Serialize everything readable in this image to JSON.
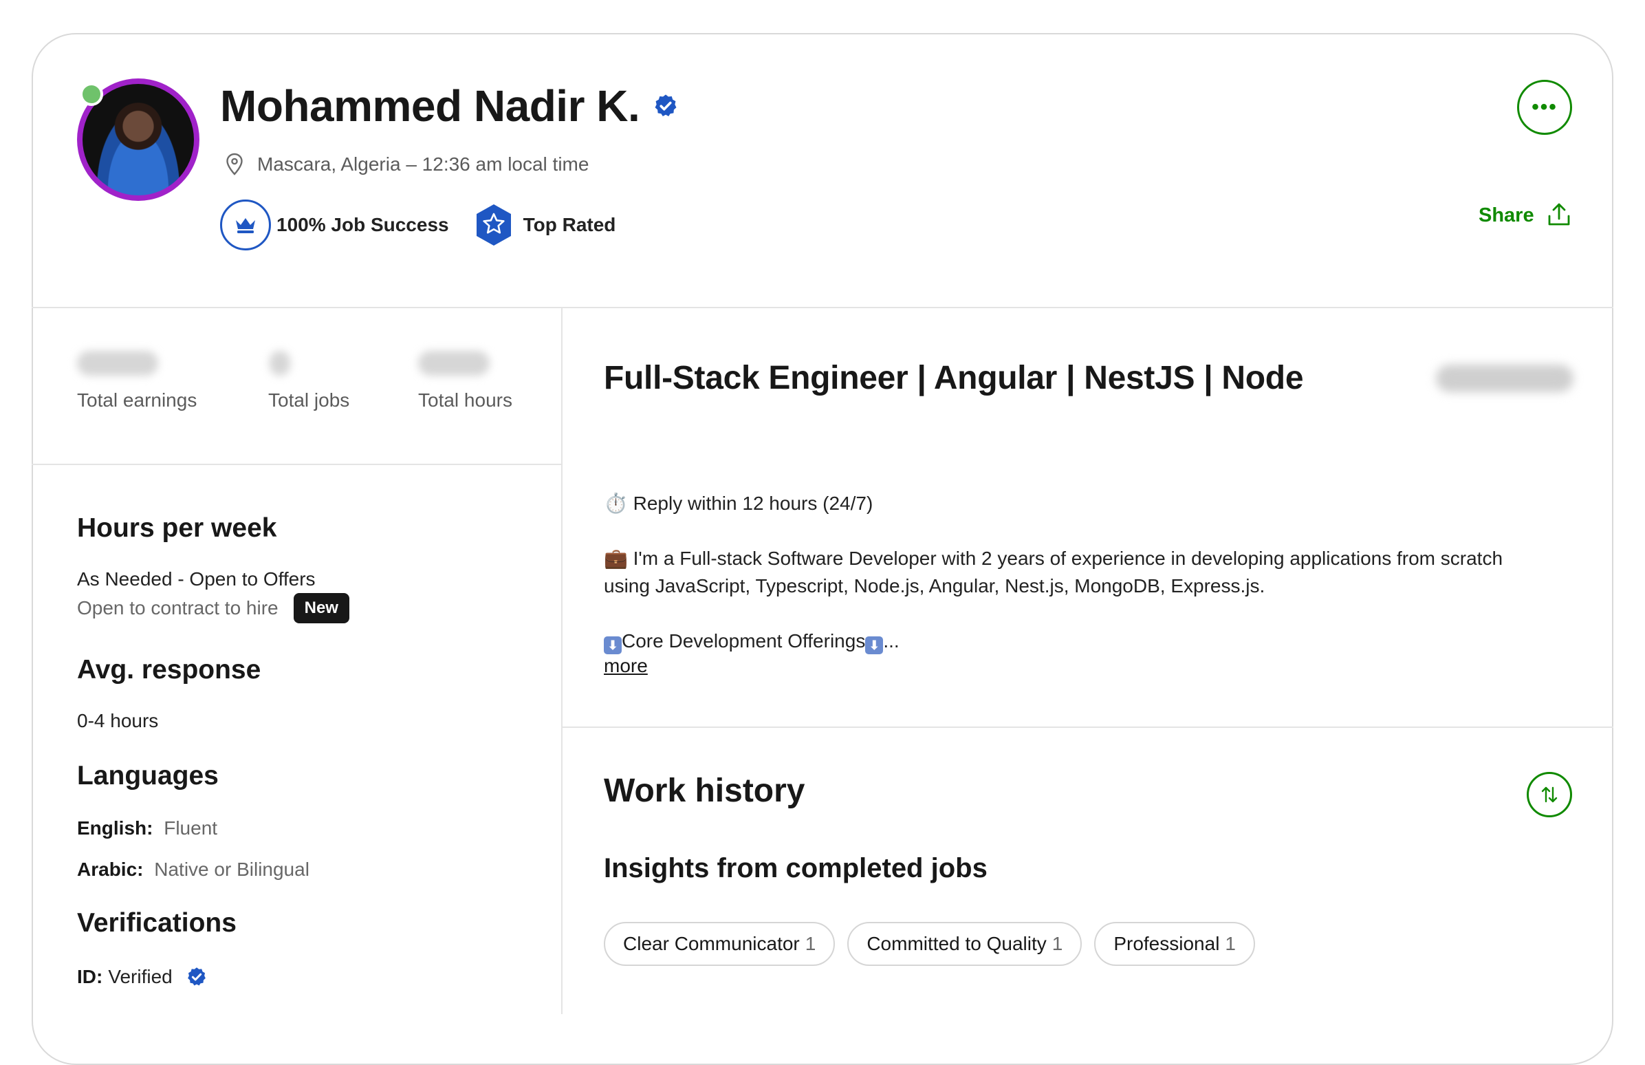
{
  "profile": {
    "name": "Mohammed Nadir K.",
    "location": "Mascara, Algeria – 12:36 am local time",
    "job_success": "100% Job Success",
    "top_rated": "Top Rated",
    "share_label": "Share"
  },
  "stats": {
    "earnings_label": "Total earnings",
    "jobs_label": "Total jobs",
    "hours_label": "Total hours"
  },
  "sidebar": {
    "hours_heading": "Hours per week",
    "hours_value": "As Needed - Open to Offers",
    "contract_text": "Open to contract to hire",
    "new_badge": "New",
    "response_heading": "Avg. response",
    "response_value": "0-4 hours",
    "languages_heading": "Languages",
    "languages": [
      {
        "name": "English:",
        "level": "Fluent"
      },
      {
        "name": "Arabic:",
        "level": "Native or Bilingual"
      }
    ],
    "verifications_heading": "Verifications",
    "id_label": "ID:",
    "id_value": "Verified"
  },
  "main": {
    "title": "Full-Stack Engineer | Angular | NestJS | Node",
    "reply": "⏱️ Reply within 12 hours (24/7)",
    "intro_line1": "💼 I'm a Full-stack Software Developer with 2 years of experience in developing applications from scratch",
    "intro_line2": "using JavaScript, Typescript, Node.js, Angular, Nest.js, MongoDB, Express.js.",
    "core_text": "Core Development Offerings",
    "ellipsis": "...",
    "more_link": "more"
  },
  "work_history": {
    "heading": "Work history",
    "insights_heading": "Insights from completed jobs",
    "chips": [
      {
        "label": "Clear Communicator",
        "count": "1"
      },
      {
        "label": "Committed to Quality",
        "count": "1"
      },
      {
        "label": "Professional",
        "count": "1"
      }
    ]
  },
  "colors": {
    "accent_green": "#108a00",
    "verified_blue": "#1f57c3",
    "avatar_ring": "#a022c9",
    "online": "#6fc26b"
  },
  "icons": [
    "location-pin-icon",
    "crown-icon",
    "star-badge-icon",
    "share-icon",
    "more-dots-icon",
    "sort-icon",
    "verified-icon",
    "down-arrow-emoji-icon"
  ]
}
